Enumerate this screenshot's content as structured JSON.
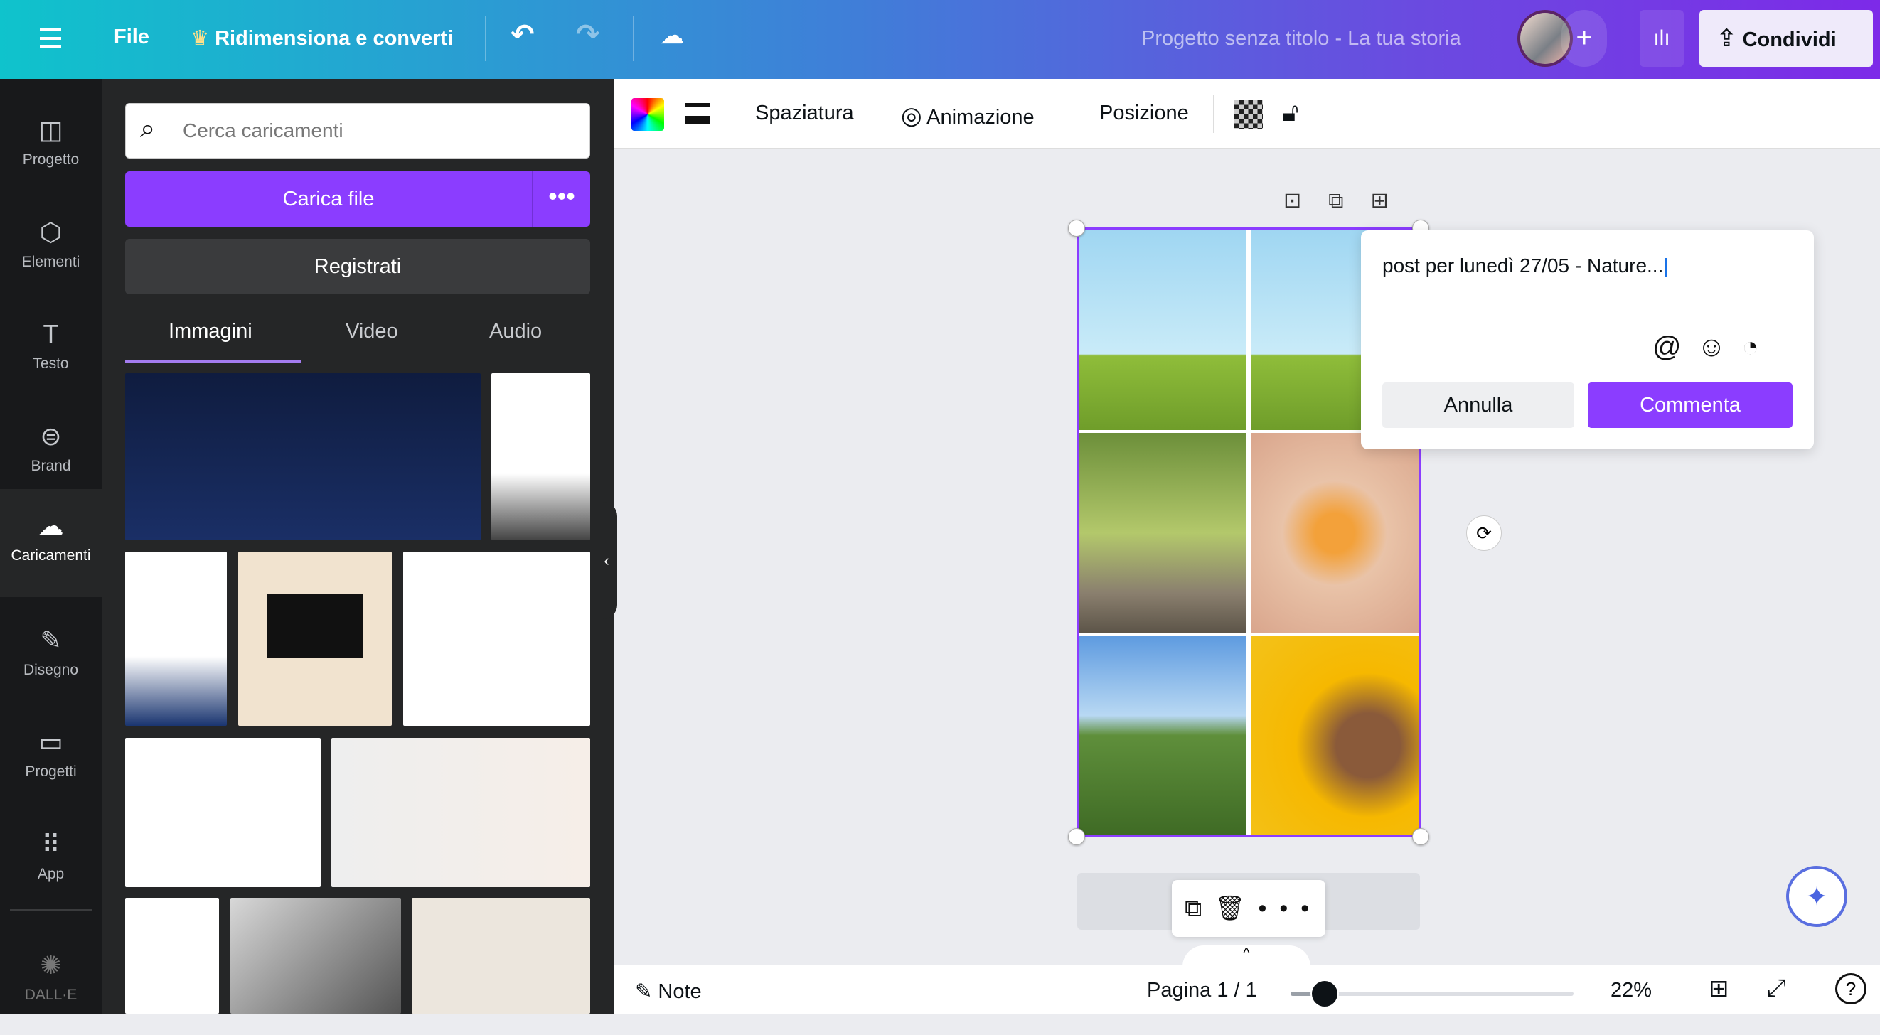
{
  "topbar": {
    "menu_icon": "hamburger-icon",
    "file": "File",
    "resize": "Ridimensiona e converti",
    "project_title": "Progetto senza titolo - La tua storia",
    "share": "Condividi"
  },
  "rail": [
    {
      "label": "Progetto",
      "icon": "layout-icon"
    },
    {
      "label": "Elementi",
      "icon": "shapes-icon"
    },
    {
      "label": "Testo",
      "icon": "text-icon"
    },
    {
      "label": "Brand",
      "icon": "brand-icon"
    },
    {
      "label": "Caricamenti",
      "icon": "cloud-upload-icon",
      "active": true
    },
    {
      "label": "Disegno",
      "icon": "draw-icon"
    },
    {
      "label": "Progetti",
      "icon": "folder-icon"
    },
    {
      "label": "App",
      "icon": "apps-icon"
    },
    {
      "label": "DALL·E",
      "icon": "dalle-icon"
    }
  ],
  "panel": {
    "search_placeholder": "Cerca caricamenti",
    "upload": "Carica file",
    "register": "Registrati",
    "tabs": [
      "Immagini",
      "Video",
      "Audio"
    ],
    "active_tab": "Immagini"
  },
  "toolbar": {
    "spacing": "Spaziatura",
    "animation": "Animazione",
    "position": "Posizione"
  },
  "comment": {
    "text": "post per lunedì 27/05 - Nature...",
    "cancel": "Annulla",
    "submit": "Commenta"
  },
  "bottom": {
    "notes": "Note",
    "page": "Pagina 1 / 1",
    "zoom": "22%",
    "zoom_level": 22
  },
  "colors": {
    "accent": "#8b3dff",
    "rail": "#18191b",
    "panel": "#252627"
  }
}
